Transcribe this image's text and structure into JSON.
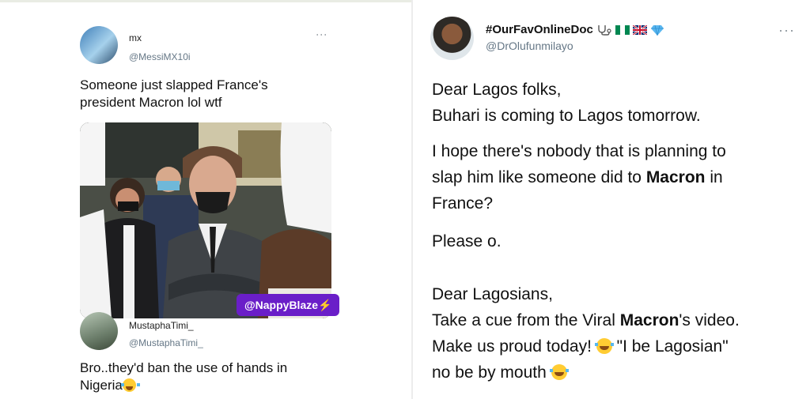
{
  "left_tweet": {
    "name": "mx",
    "handle": "@MessiMX10i",
    "text": "Someone just slapped France's president Macron lol wtf",
    "watermark": "@NappyBlaze"
  },
  "reply_tweet": {
    "name": "MustaphaTimi_",
    "handle": "@MustaphaTimi_",
    "text_line1": "Bro..they'd ban the use of hands in",
    "text_line2": "Nigeria"
  },
  "right_tweet": {
    "name": "#OurFavOnlineDoc",
    "handle": "@DrOlufunmilayo",
    "p1_l1": "Dear Lagos folks,",
    "p1_l2": "Buhari is coming to Lagos tomorrow.",
    "p2_a": "I hope there's nobody that is planning to",
    "p2_b": "slap him like someone did to ",
    "p2_bold": "Macron",
    "p2_c": " in",
    "p2_d": "France?",
    "p3": "Please o.",
    "p4_l1": "Dear Lagosians,",
    "p4_l2a": "Take a cue from the Viral ",
    "p4_bold": "Macron",
    "p4_l2b": "'s video.",
    "p4_l3a": "Make us proud today! ",
    "p4_l3b": " \"I be Lagosian\"",
    "p4_l4": "no be by mouth "
  },
  "icons": {
    "more_vertical": "⋮",
    "more_horizontal": "···",
    "bolt": "⚡"
  },
  "colors": {
    "badge": "#6a1ec8",
    "handle": "#657786"
  }
}
